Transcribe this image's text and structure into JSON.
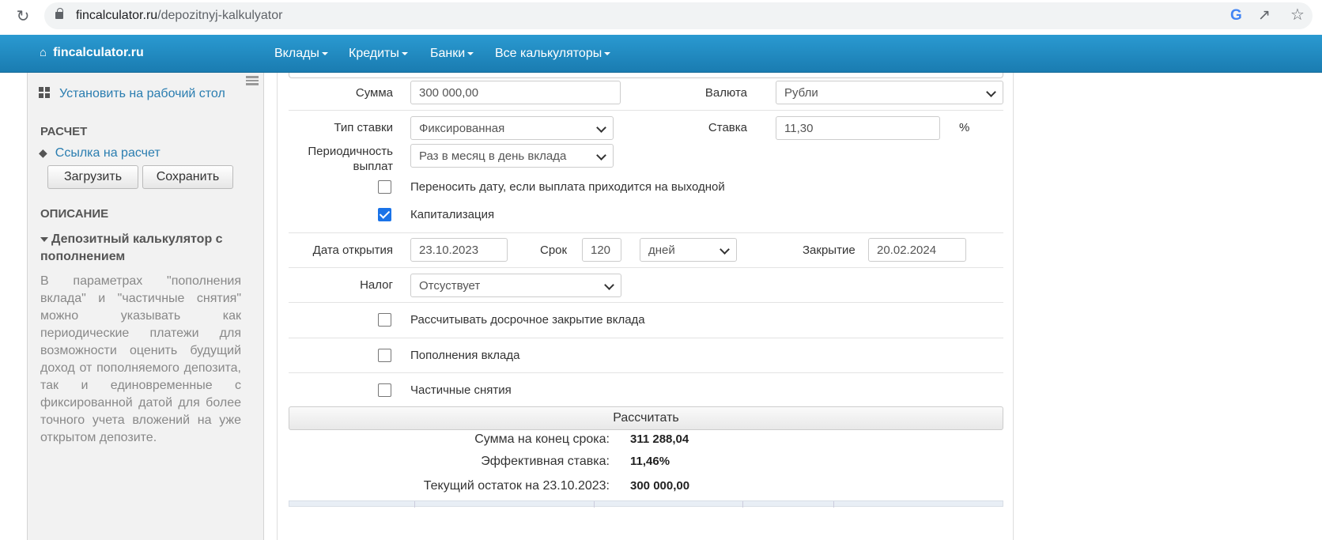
{
  "browser": {
    "url_host": "fincalculator.ru",
    "url_path": "/depozitnyj-kalkulyator",
    "icons": [
      "reload-icon",
      "lock-icon",
      "google-icon",
      "share-icon",
      "star-icon"
    ],
    "google_glyph": "G"
  },
  "navbar": {
    "brand": "fincalculator.ru",
    "items": [
      {
        "label": "Вклады"
      },
      {
        "label": "Кредиты"
      },
      {
        "label": "Банки"
      },
      {
        "label": "Все калькуляторы"
      }
    ]
  },
  "sidebar": {
    "install_link": "Установить на рабочий стол",
    "section_calc": "РАСЧЕТ",
    "calc_link": "Ссылка на расчет",
    "load_button": "Загрузить",
    "save_button": "Сохранить",
    "section_desc": "ОПИСАНИЕ",
    "desc_title": "Депозитный калькулятор с пополнением",
    "desc_text": "В параметрах \"пополнения вклада\" и \"частичные снятия\" можно указывать как периодические платежи для возможности оценить будущий доход от пополняемого депозита, так и единовременные с фиксированной датой для более точного учета вложений на уже открытом депозите."
  },
  "form": {
    "sum_label": "Сумма",
    "sum_value": "300 000,00",
    "currency_label": "Валюта",
    "currency_value": "Рубли",
    "rate_type_label": "Тип ставки",
    "rate_type_value": "Фиксированная",
    "rate_label": "Ставка",
    "rate_value": "11,30",
    "rate_unit": "%",
    "period_label": "Периодичность выплат",
    "period_value": "Раз в месяц в день вклада",
    "move_date_label": "Переносить дату, если выплата приходится на выходной",
    "move_date_checked": false,
    "capitalization_label": "Капитализация",
    "capitalization_checked": true,
    "open_date_label": "Дата открытия",
    "open_date_value": "23.10.2023",
    "term_label": "Срок",
    "term_value": "120",
    "term_unit_value": "дней",
    "close_label": "Закрытие",
    "close_value": "20.02.2024",
    "tax_label": "Налог",
    "tax_value": "Отсуствует",
    "early_close_label": "Рассчитывать досрочное закрытие вклада",
    "topups_label": "Пополнения вклада",
    "withdrawals_label": "Частичные снятия",
    "calculate_button": "Рассчитать"
  },
  "results": {
    "end_sum_label": "Сумма на конец срока:",
    "end_sum_value": "311 288,04",
    "effective_rate_label": "Эффективная ставка:",
    "effective_rate_value": "11,46%",
    "current_balance_label": "Текущий остаток на 23.10.2023:",
    "current_balance_value": "300 000,00"
  }
}
